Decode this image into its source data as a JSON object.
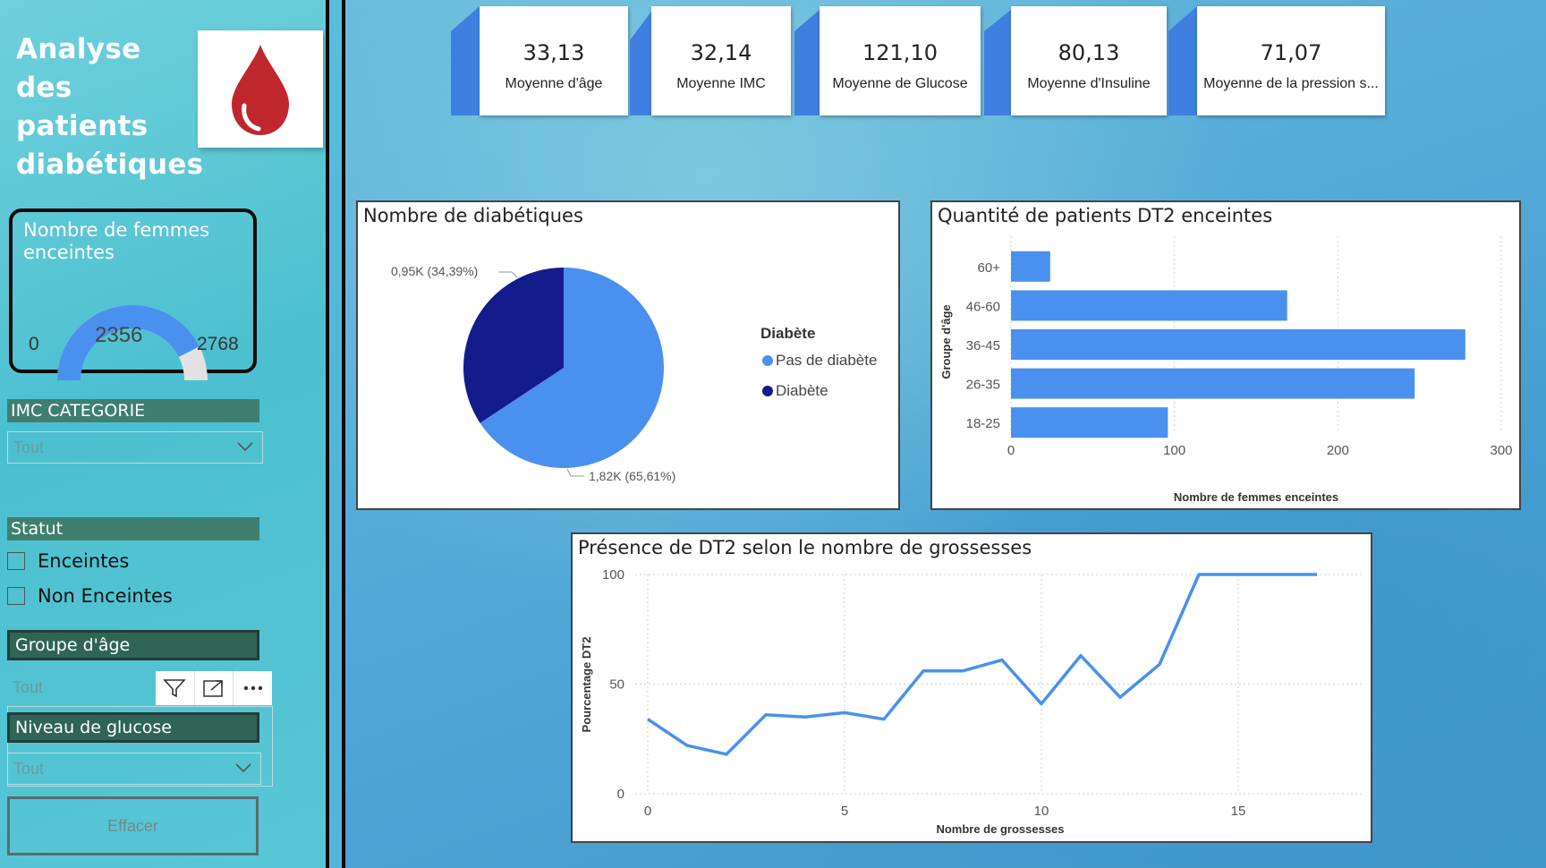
{
  "sidebar": {
    "title": "Analyse des patients diabétiques",
    "gauge": {
      "title": "Nombre de femmes enceintes",
      "min": "0",
      "value": "2356",
      "max": "2768"
    },
    "imc": {
      "header": "IMC CATEGORIE",
      "value": "Tout"
    },
    "statut": {
      "header": "Statut",
      "options": [
        "Enceintes",
        "Non Enceintes"
      ]
    },
    "age_group": {
      "header": "Groupe d'âge",
      "value": "Tout"
    },
    "glucose": {
      "header": "Niveau de glucose",
      "value": "Tout"
    },
    "clear_label": "Effacer"
  },
  "kpis": [
    {
      "value": "33,13",
      "label": "Moyenne d'âge"
    },
    {
      "value": "32,14",
      "label": "Moyenne IMC"
    },
    {
      "value": "121,10",
      "label": "Moyenne de Glucose"
    },
    {
      "value": "80,13",
      "label": "Moyenne d'Insuline"
    },
    {
      "value": "71,07",
      "label": "Moyenne de la pression s..."
    }
  ],
  "colors": {
    "light_blue": "#4a90ee",
    "dark_blue": "#141b8c",
    "blood_red": "#c0272d"
  },
  "chart_data": [
    {
      "type": "pie",
      "title": "Nombre de diabétiques",
      "legend_title": "Diabète",
      "slices": [
        {
          "name": "Pas de diabète",
          "value": 1.82,
          "label": "1,82K (65,61%)"
        },
        {
          "name": "Diabète",
          "value": 0.95,
          "label": "0,95K (34,39%)"
        }
      ]
    },
    {
      "type": "bar",
      "title": "Quantité de patients DT2 enceintes",
      "categories": [
        "60+",
        "46-60",
        "36-45",
        "26-35",
        "18-25"
      ],
      "values": [
        24,
        169,
        278,
        247,
        96
      ],
      "xlabel": "Nombre de femmes enceintes",
      "ylabel": "Groupe d'âge",
      "xlim": [
        0,
        300
      ],
      "xticks": [
        "0",
        "100",
        "200",
        "300"
      ]
    },
    {
      "type": "line",
      "title": "Présence de DT2 selon le nombre de grossesses",
      "x": [
        0,
        1,
        2,
        3,
        4,
        5,
        6,
        7,
        8,
        9,
        10,
        11,
        12,
        13,
        14,
        15,
        16,
        17
      ],
      "values": [
        34,
        22,
        18,
        36,
        35,
        37,
        34,
        56,
        56,
        61,
        41,
        63,
        44,
        59,
        100,
        100,
        100,
        100
      ],
      "xlabel": "Nombre de grossesses",
      "ylabel": "Pourcentage DT2",
      "ylim": [
        0,
        100
      ],
      "xticks": [
        "0",
        "5",
        "10",
        "15"
      ],
      "yticks": [
        "0",
        "50",
        "100"
      ]
    }
  ]
}
